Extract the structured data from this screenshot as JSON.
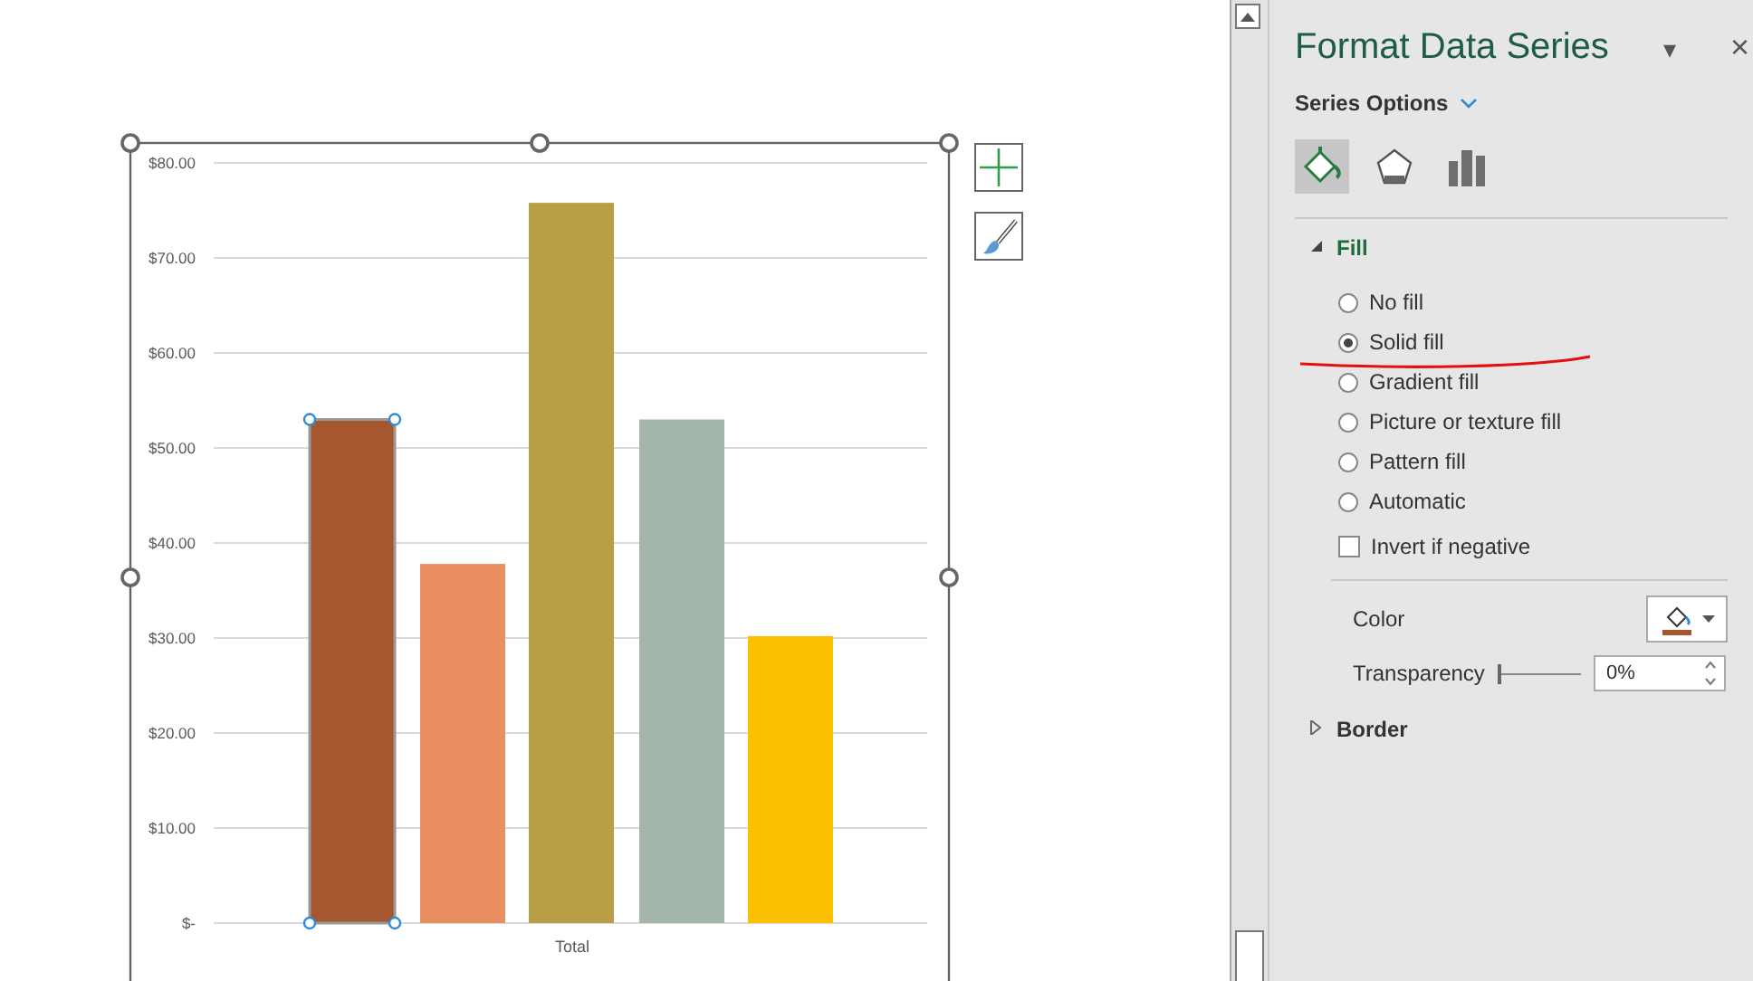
{
  "chart": {
    "bars": [
      {
        "selected": true
      },
      {
        "selected": false
      },
      {
        "selected": false
      },
      {
        "selected": false
      },
      {
        "selected": false
      }
    ],
    "chart_data": {
      "type": "bar",
      "categories": [
        "Total"
      ],
      "ylim": [
        0,
        80
      ],
      "grid": true,
      "yticks": [
        {
          "value": 0,
          "label": "$-"
        },
        {
          "value": 10,
          "label": "$10.00"
        },
        {
          "value": 20,
          "label": "$20.00"
        },
        {
          "value": 30,
          "label": "$30.00"
        },
        {
          "value": 40,
          "label": "$40.00"
        },
        {
          "value": 50,
          "label": "$50.00"
        },
        {
          "value": 60,
          "label": "$60.00"
        },
        {
          "value": 70,
          "label": "$70.00"
        },
        {
          "value": 80,
          "label": "$80.00"
        }
      ],
      "series": [
        {
          "color": "#a5582f",
          "values": [
            53
          ]
        },
        {
          "color": "#e98f5f",
          "values": [
            37.8
          ]
        },
        {
          "color": "#b89e44",
          "values": [
            75.8
          ]
        },
        {
          "color": "#a4b6aa",
          "values": [
            53
          ]
        },
        {
          "color": "#fdc000",
          "values": [
            30.2
          ]
        }
      ]
    }
  },
  "panel": {
    "title": "Format Data Series",
    "menu_caret": "▾",
    "close": "×",
    "options_label": "Series Options",
    "tabs": [
      {
        "kind": "fill",
        "selected": true
      },
      {
        "kind": "effects",
        "selected": false
      },
      {
        "kind": "series",
        "selected": false
      }
    ],
    "sections": [
      {
        "title": "Fill",
        "expanded": true,
        "options": [
          {
            "label": "No fill",
            "selected": false
          },
          {
            "label": "Solid fill",
            "selected": true
          },
          {
            "label": "Gradient fill",
            "selected": false
          },
          {
            "label": "Picture or texture fill",
            "selected": false
          },
          {
            "label": "Pattern fill",
            "selected": false
          },
          {
            "label": "Automatic",
            "selected": false
          }
        ],
        "invert": {
          "label": "Invert if negative",
          "checked": false
        },
        "color": {
          "label": "Color",
          "color": "#a5582f"
        },
        "transparency": {
          "label": "Transparency",
          "level": 0,
          "value": "0%"
        }
      },
      {
        "title": "Border",
        "expanded": false
      }
    ]
  }
}
